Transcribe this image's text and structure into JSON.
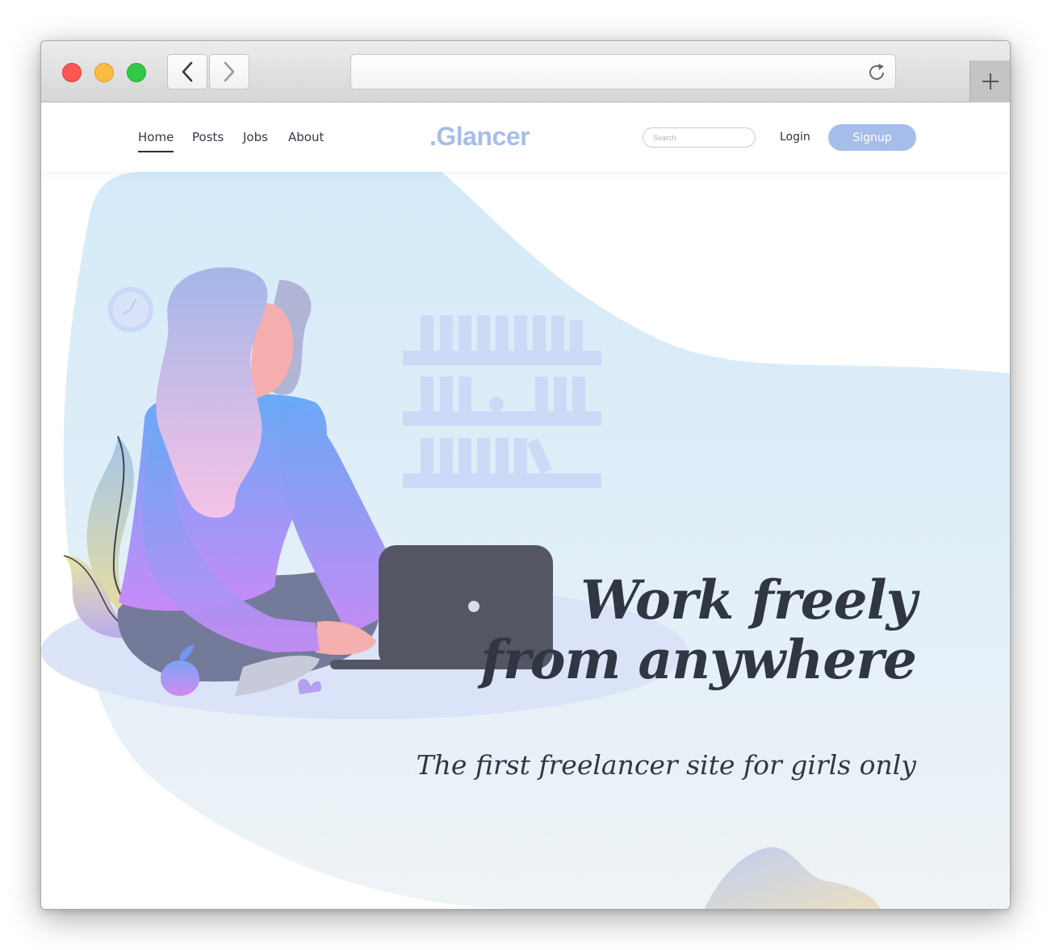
{
  "nav": {
    "links": [
      "Home",
      "Posts",
      "Jobs",
      "About"
    ],
    "active": "Home"
  },
  "brand": {
    "logo": ".Glancer"
  },
  "search": {
    "placeholder": "Search"
  },
  "auth": {
    "login": "Login",
    "signup": "Signup"
  },
  "hero": {
    "headline_line1": "Work freely",
    "headline_line2": "from anywhere",
    "subtitle": "The first freelancer site for girls only"
  },
  "colors": {
    "accent": "#a7bdea",
    "text_dark": "#313644",
    "laptop": "#545663",
    "hero_blob": "#dceef8"
  },
  "icons": [
    "back-arrow-icon",
    "forward-arrow-icon",
    "reload-icon",
    "plus-icon"
  ]
}
